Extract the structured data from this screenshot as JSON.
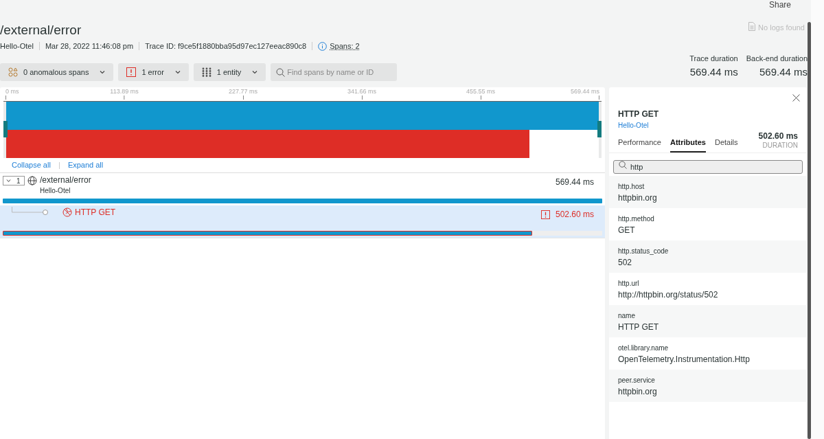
{
  "top_actions": {
    "share": "Share"
  },
  "header": {
    "title": "/external/error",
    "service": "Hello-Otel",
    "date": "Mar 28, 2022 11:46:08 pm",
    "trace_id": "Trace ID: f9ce5f1880bba95d97ec127eeac890c8",
    "spans": "Spans: 2",
    "logs": "No logs found"
  },
  "filters": [
    {
      "kind": "anomaly",
      "label": "0 anomalous spans"
    },
    {
      "kind": "error",
      "label": "1 error"
    },
    {
      "kind": "entity",
      "label": "1 entity"
    }
  ],
  "search": {
    "placeholder": "Find spans by name or ID"
  },
  "durations": [
    {
      "label": "Trace duration",
      "value": "569.44 ms"
    },
    {
      "label": "Back-end duration",
      "value": "569.44 ms"
    }
  ],
  "axis_ticks": [
    "0 ms",
    "113.89 ms",
    "227.77 ms",
    "341.66 ms",
    "455.55 ms",
    "569.44 ms"
  ],
  "tree_actions": [
    "Collapse all",
    "Expand all"
  ],
  "spans": [
    {
      "name": "/external/error",
      "service": "Hello-Otel",
      "duration": "569.44 ms",
      "level": 1,
      "error": false,
      "selected": false,
      "expanded": true,
      "count": "1",
      "color": "#1197cd"
    },
    {
      "name": "HTTP GET",
      "duration": "502.60 ms",
      "level": 0.883,
      "error": true,
      "selected": true,
      "color": "#de2d26"
    }
  ],
  "panel": {
    "title": "HTTP GET",
    "service": "Hello-Otel",
    "tabs": [
      {
        "label": "Performance",
        "selected": false
      },
      {
        "label": "Attributes",
        "selected": true
      },
      {
        "label": "Details",
        "selected": false
      }
    ],
    "duration": "502.60 ms",
    "duration_label": "DURATION",
    "filter": "http",
    "attributes": [
      {
        "key": "http.host",
        "value": "httpbin.org"
      },
      {
        "key": "http.method",
        "value": "GET"
      },
      {
        "key": "http.status_code",
        "value": "502"
      },
      {
        "key": "http.url",
        "value": "http://httpbin.org/status/502"
      },
      {
        "key": "name",
        "value": "HTTP GET"
      },
      {
        "key": "otel.library.name",
        "value": "OpenTelemetry.Instrumentation.Http"
      },
      {
        "key": "peer.service",
        "value": "httpbin.org"
      }
    ]
  }
}
